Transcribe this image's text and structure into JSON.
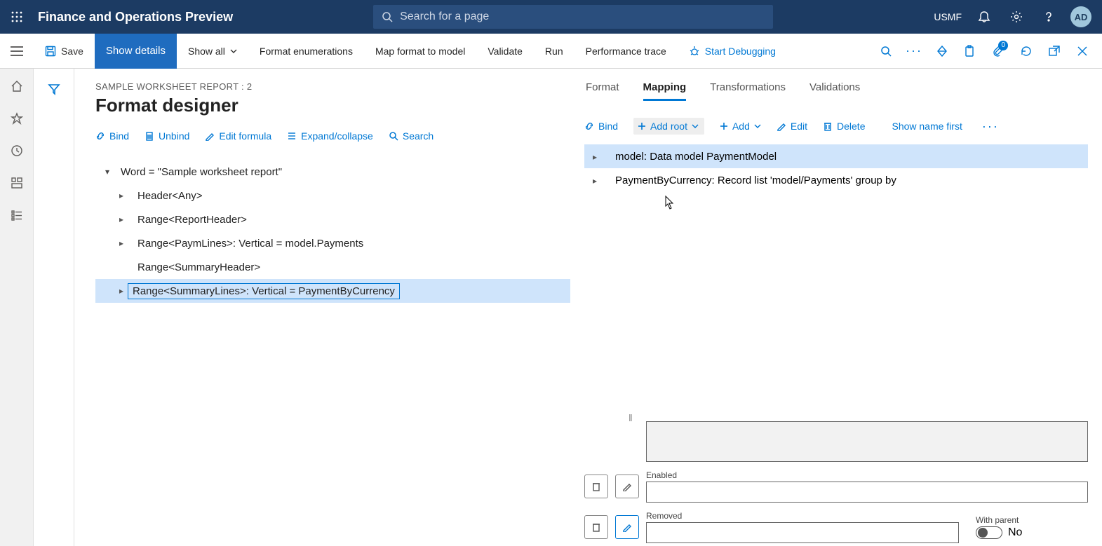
{
  "header": {
    "app_title": "Finance and Operations Preview",
    "search_placeholder": "Search for a page",
    "company": "USMF",
    "avatar_initials": "AD"
  },
  "actionbar": {
    "save": "Save",
    "show_details": "Show details",
    "show_all": "Show all",
    "format_enum": "Format enumerations",
    "map_format": "Map format to model",
    "validate": "Validate",
    "run": "Run",
    "perf_trace": "Performance trace",
    "start_debug": "Start Debugging"
  },
  "page": {
    "breadcrumb": "SAMPLE WORKSHEET REPORT : 2",
    "title": "Format designer"
  },
  "left_toolbar": {
    "bind": "Bind",
    "unbind": "Unbind",
    "edit_formula": "Edit formula",
    "expand": "Expand/collapse",
    "search": "Search"
  },
  "format_tree": {
    "root": "Word = \"Sample worksheet report\"",
    "items": [
      "Header<Any>",
      "Range<ReportHeader>",
      "Range<PaymLines>: Vertical = model.Payments",
      "Range<SummaryHeader>",
      "Range<SummaryLines>: Vertical = PaymentByCurrency"
    ]
  },
  "right_tabs": {
    "format": "Format",
    "mapping": "Mapping",
    "transformations": "Transformations",
    "validations": "Validations"
  },
  "map_toolbar": {
    "bind": "Bind",
    "add_root": "Add root",
    "add": "Add",
    "edit": "Edit",
    "delete": "Delete",
    "show_name": "Show name first"
  },
  "map_tree": {
    "items": [
      "model: Data model PaymentModel",
      "PaymentByCurrency: Record list 'model/Payments' group by"
    ]
  },
  "props": {
    "enabled_label": "Enabled",
    "removed_label": "Removed",
    "with_parent_label": "With parent",
    "with_parent_value": "No"
  }
}
